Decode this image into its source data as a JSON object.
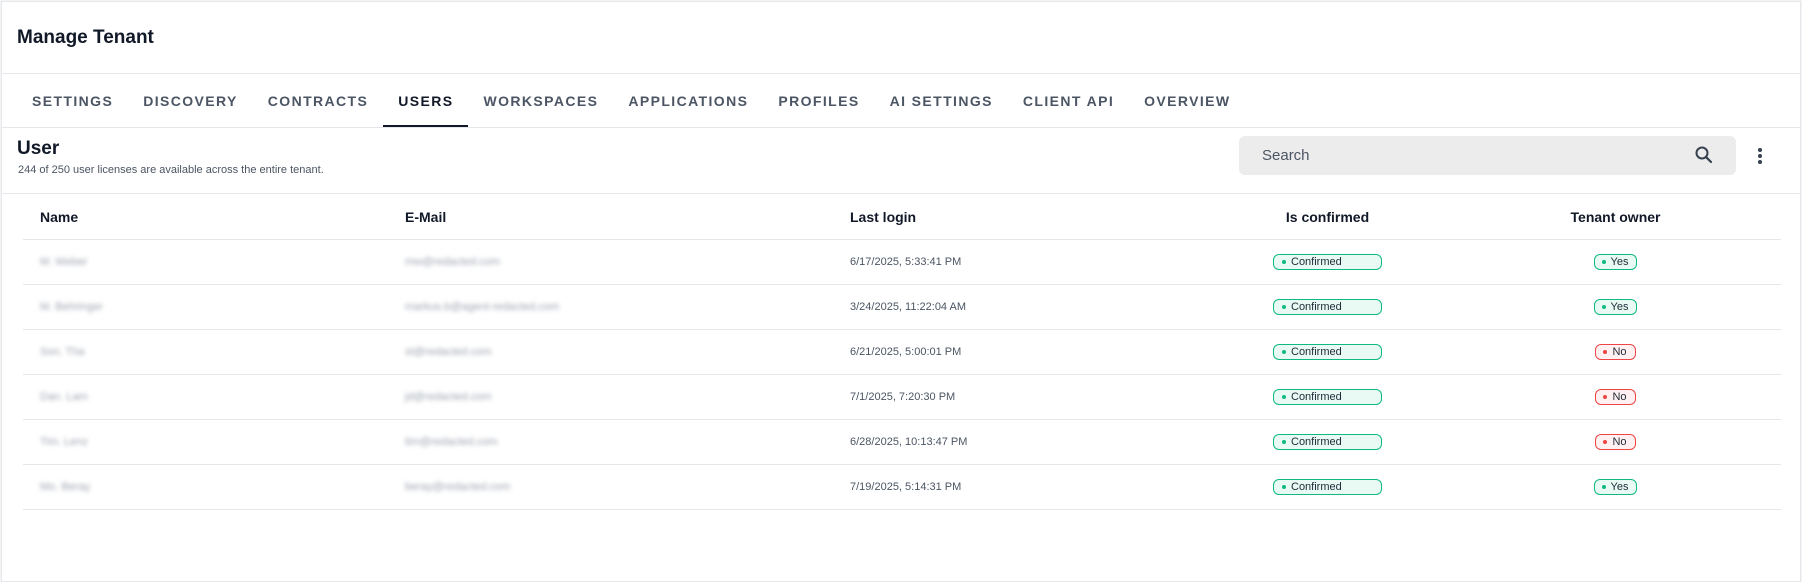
{
  "header": {
    "title": "Manage Tenant"
  },
  "tabs": [
    {
      "label": "SETTINGS",
      "active": false
    },
    {
      "label": "DISCOVERY",
      "active": false
    },
    {
      "label": "CONTRACTS",
      "active": false
    },
    {
      "label": "USERS",
      "active": true
    },
    {
      "label": "WORKSPACES",
      "active": false
    },
    {
      "label": "APPLICATIONS",
      "active": false
    },
    {
      "label": "PROFILES",
      "active": false
    },
    {
      "label": "AI SETTINGS",
      "active": false
    },
    {
      "label": "CLIENT API",
      "active": false
    },
    {
      "label": "OVERVIEW",
      "active": false
    }
  ],
  "section": {
    "title": "User",
    "subtitle": "244 of 250 user licenses are available across the entire tenant."
  },
  "search": {
    "placeholder": "Search",
    "icon": "search-icon"
  },
  "menu": {
    "icon": "kebab-menu-icon"
  },
  "table": {
    "columns": {
      "name": "Name",
      "email": "E-Mail",
      "last_login": "Last login",
      "confirmed": "Is confirmed",
      "owner": "Tenant owner"
    },
    "rows": [
      {
        "name": "M. Weber",
        "email": "mw@redacted.com",
        "last_login": "6/17/2025, 5:33:41 PM",
        "confirmed": "Confirmed",
        "owner": "Yes"
      },
      {
        "name": "M. Behringer",
        "email": "markus.b@agent-redacted.com",
        "last_login": "3/24/2025, 11:22:04 AM",
        "confirmed": "Confirmed",
        "owner": "Yes"
      },
      {
        "name": "Son. Tha",
        "email": "st@redacted.com",
        "last_login": "6/21/2025, 5:00:01 PM",
        "confirmed": "Confirmed",
        "owner": "No"
      },
      {
        "name": "Dan. Lam",
        "email": "jd@redacted.com",
        "last_login": "7/1/2025, 7:20:30 PM",
        "confirmed": "Confirmed",
        "owner": "No"
      },
      {
        "name": "Tim. Lenz",
        "email": "tim@redacted.com",
        "last_login": "6/28/2025, 10:13:47 PM",
        "confirmed": "Confirmed",
        "owner": "No"
      },
      {
        "name": "Mo. Beray",
        "email": "beray@redacted.com",
        "last_login": "7/19/2025, 5:14:31 PM",
        "confirmed": "Confirmed",
        "owner": "Yes"
      }
    ]
  },
  "colors": {
    "confirmed_green": "#10b981",
    "no_red": "#ef4444",
    "active_tab": "#111827"
  }
}
